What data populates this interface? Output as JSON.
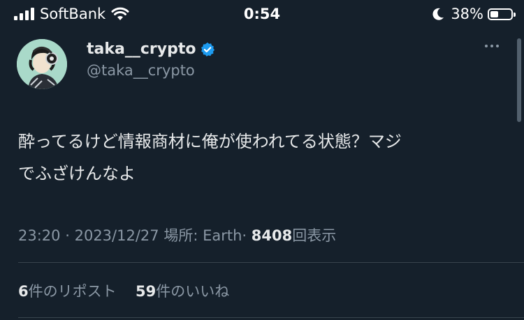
{
  "status_bar": {
    "carrier": "SoftBank",
    "time": "0:54",
    "battery_percent": "38%",
    "battery_level": 0.38,
    "icons": [
      "signal-bars-icon",
      "wifi-icon",
      "moon-icon",
      "battery-icon"
    ]
  },
  "tweet": {
    "author": {
      "display_name": "taka__crypto",
      "handle": "@taka__crypto",
      "verified": true
    },
    "text_lines": [
      "酔ってるけど情報商材に俺が使われてる状態？マジ",
      "でふざけんなよ"
    ],
    "meta": {
      "time": "23:20",
      "date": "2023/12/27",
      "location_label": "場所:",
      "location": "Earth",
      "views": "8408",
      "views_label": "回表示",
      "separator": "·"
    },
    "stats": {
      "reposts_count": "6",
      "reposts_label": "件のリポスト",
      "likes_count": "59",
      "likes_label": "件のいいね"
    }
  },
  "colors": {
    "background": "#15202b",
    "text_primary": "#e7e9ea",
    "text_secondary": "#8b98a5",
    "verified_blue": "#1d9bf0",
    "divider": "#38444d"
  }
}
